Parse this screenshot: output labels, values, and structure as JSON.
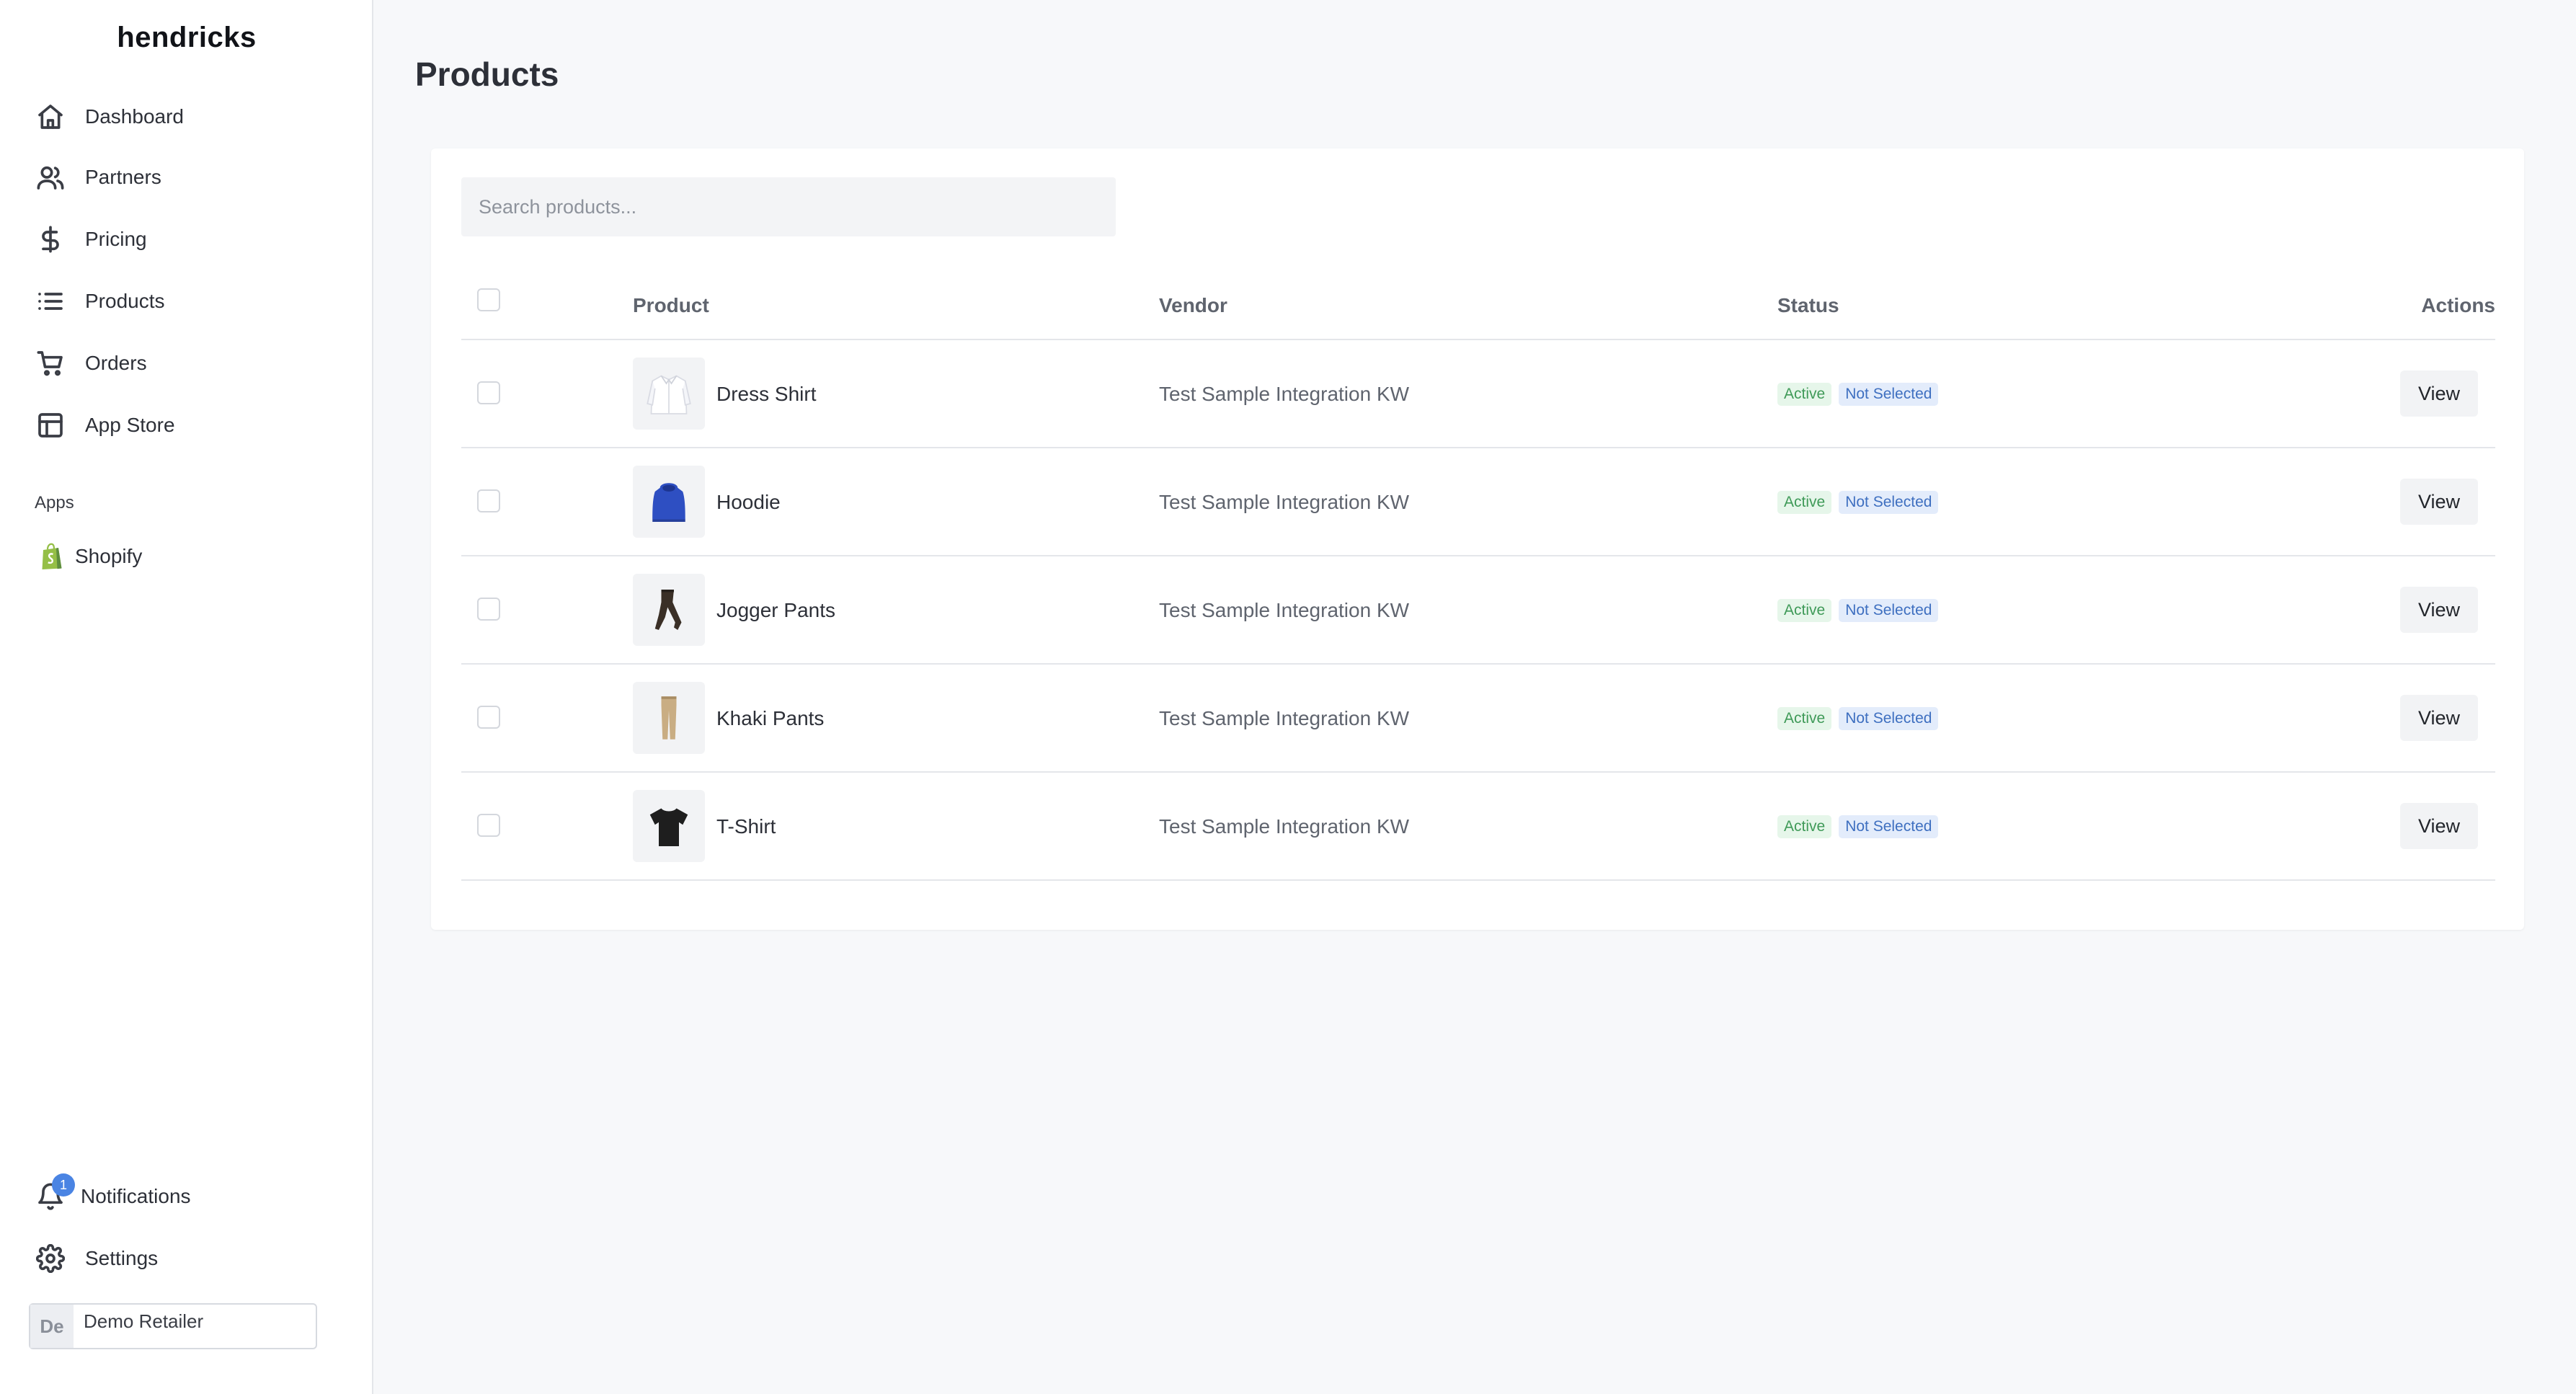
{
  "brand": "hendricks",
  "sidebar": {
    "items": [
      {
        "label": "Dashboard",
        "icon": "home-icon"
      },
      {
        "label": "Partners",
        "icon": "users-icon"
      },
      {
        "label": "Pricing",
        "icon": "dollar-icon"
      },
      {
        "label": "Products",
        "icon": "list-icon"
      },
      {
        "label": "Orders",
        "icon": "cart-icon"
      },
      {
        "label": "App Store",
        "icon": "layout-icon"
      }
    ],
    "apps_section": "Apps",
    "apps": [
      {
        "label": "Shopify",
        "icon": "shopify-icon"
      }
    ],
    "notifications": {
      "label": "Notifications",
      "count": "1"
    },
    "settings": {
      "label": "Settings"
    },
    "account": {
      "initials": "De",
      "name": "Demo Retailer"
    }
  },
  "page": {
    "title": "Products",
    "search_placeholder": "Search products..."
  },
  "table": {
    "headers": {
      "product": "Product",
      "vendor": "Vendor",
      "status": "Status",
      "actions": "Actions"
    },
    "rows": [
      {
        "name": "Dress Shirt",
        "vendor": "Test Sample Integration KW",
        "status": "Active",
        "selection": "Not Selected",
        "action": "View",
        "thumb": "dress-shirt"
      },
      {
        "name": "Hoodie",
        "vendor": "Test Sample Integration KW",
        "status": "Active",
        "selection": "Not Selected",
        "action": "View",
        "thumb": "hoodie"
      },
      {
        "name": "Jogger Pants",
        "vendor": "Test Sample Integration KW",
        "status": "Active",
        "selection": "Not Selected",
        "action": "View",
        "thumb": "jogger-pants"
      },
      {
        "name": "Khaki Pants",
        "vendor": "Test Sample Integration KW",
        "status": "Active",
        "selection": "Not Selected",
        "action": "View",
        "thumb": "khaki-pants"
      },
      {
        "name": "T-Shirt",
        "vendor": "Test Sample Integration KW",
        "status": "Active",
        "selection": "Not Selected",
        "action": "View",
        "thumb": "t-shirt"
      }
    ]
  },
  "colors": {
    "accent": "#4a84e3",
    "active_badge_bg": "#e6f6ea",
    "active_badge_text": "#3f9a58",
    "not_selected_bg": "#e3ecfb",
    "not_selected_text": "#3e6fc0"
  }
}
